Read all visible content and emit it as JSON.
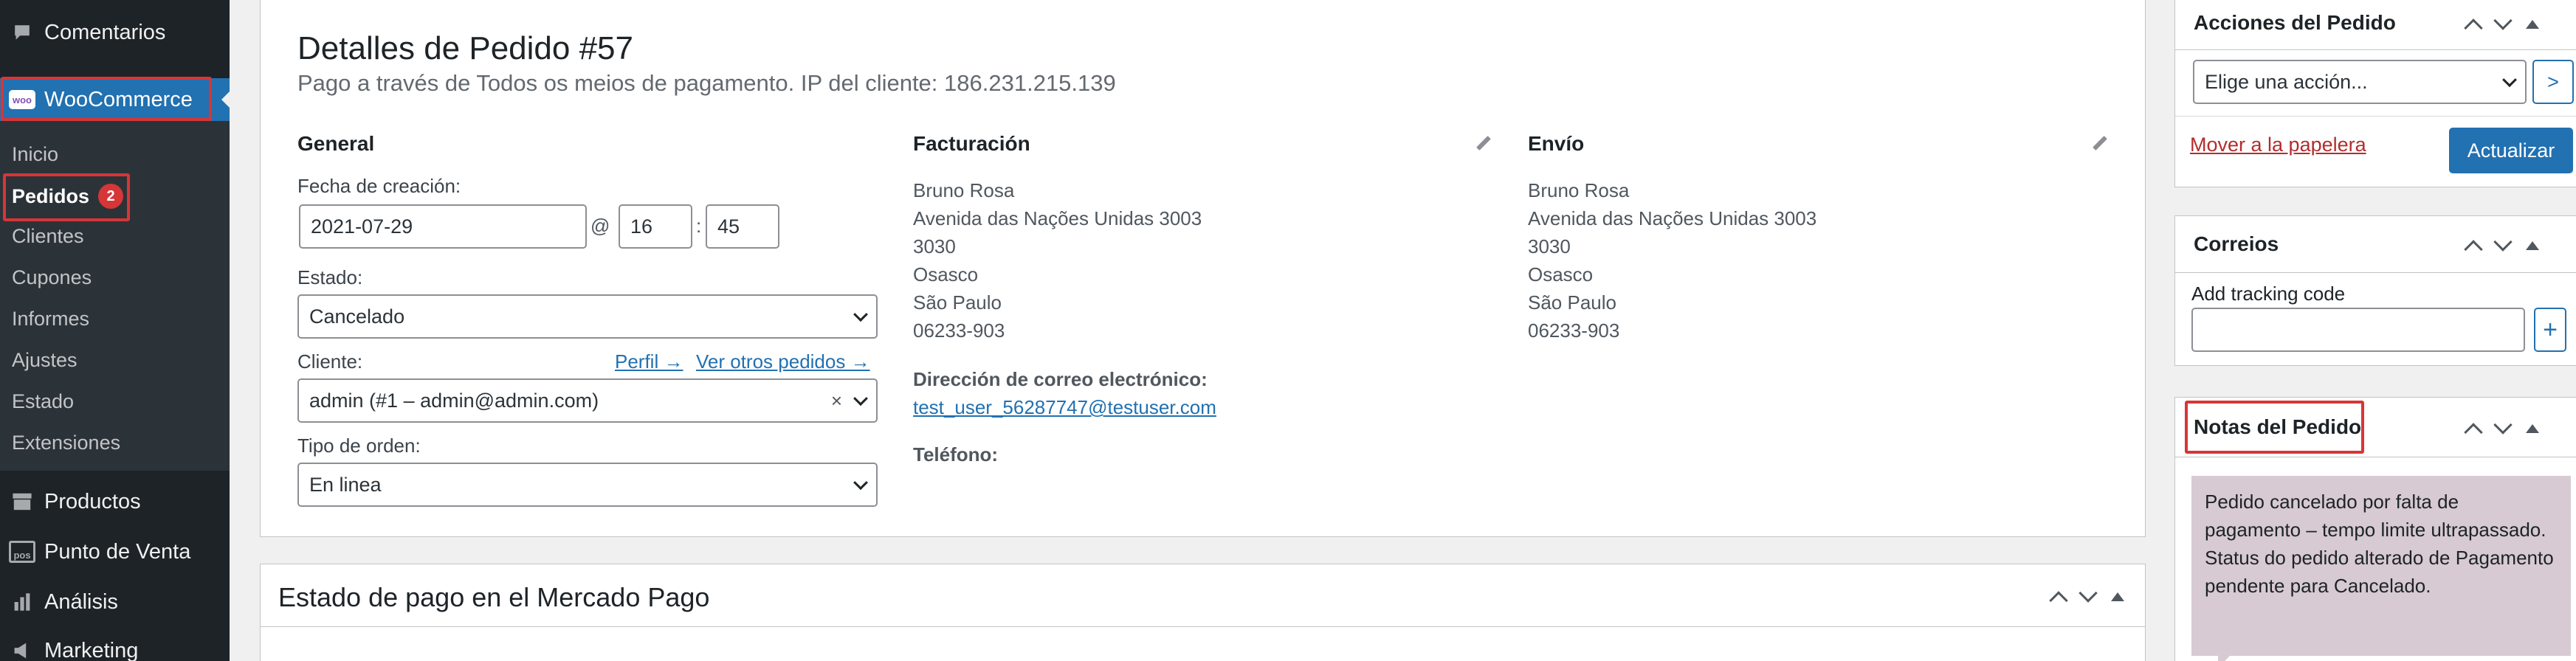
{
  "sidebar": {
    "comments": "Comentarios",
    "woocommerce": "WooCommerce",
    "woo_logo": "woo",
    "submenu": [
      "Inicio",
      "Pedidos",
      "Clientes",
      "Cupones",
      "Informes",
      "Ajustes",
      "Estado",
      "Extensiones"
    ],
    "orders_badge": "2",
    "products": "Productos",
    "pos": "Punto de Venta",
    "pos_icon_text": "pos",
    "analytics": "Análisis",
    "marketing": "Marketing"
  },
  "order": {
    "title": "Detalles de Pedido #57",
    "subtitle": "Pago a través de Todos os meios de pagamento. IP del cliente: 186.231.215.139",
    "general": {
      "heading": "General",
      "date_label": "Fecha de creación:",
      "date": "2021-07-29",
      "at": "@",
      "hour": "16",
      "colon": ":",
      "minute": "45",
      "status_label": "Estado:",
      "status": "Cancelado",
      "customer_label": "Cliente:",
      "profile_link": "Perfil →",
      "other_orders_link": "Ver otros pedidos →",
      "customer": "admin (#1 – admin@admin.com)",
      "clear": "×",
      "order_type_label": "Tipo de orden:",
      "order_type": "En linea"
    },
    "billing": {
      "heading": "Facturación",
      "lines": [
        "Bruno Rosa",
        "Avenida das Nações Unidas 3003",
        "3030",
        "Osasco",
        "São Paulo",
        "06233-903"
      ],
      "email_label": "Dirección de correo electrónico:",
      "email": "test_user_56287747@testuser.com",
      "phone_label": "Teléfono:"
    },
    "shipping": {
      "heading": "Envío",
      "lines": [
        "Bruno Rosa",
        "Avenida das Nações Unidas 3003",
        "3030",
        "Osasco",
        "São Paulo",
        "06233-903"
      ]
    }
  },
  "mercado": {
    "title": "Estado de pago en el Mercado Pago"
  },
  "actions": {
    "title": "Acciones del Pedido",
    "select": "Elige una acción...",
    "go": ">",
    "trash": "Mover a la papelera",
    "update": "Actualizar"
  },
  "correios": {
    "title": "Correios",
    "label": "Add tracking code",
    "add": "+"
  },
  "notes": {
    "title": "Notas del Pedido",
    "note": "Pedido cancelado por falta de pagamento – tempo limite ultrapassado. Status do pedido alterado de Pagamento pendente para Cancelado."
  },
  "colors": {
    "sidebar": "#1d2327",
    "accent": "#2271b1",
    "badge": "#d63638",
    "note_bg": "#d7cad2",
    "highlight": "#d63638"
  }
}
